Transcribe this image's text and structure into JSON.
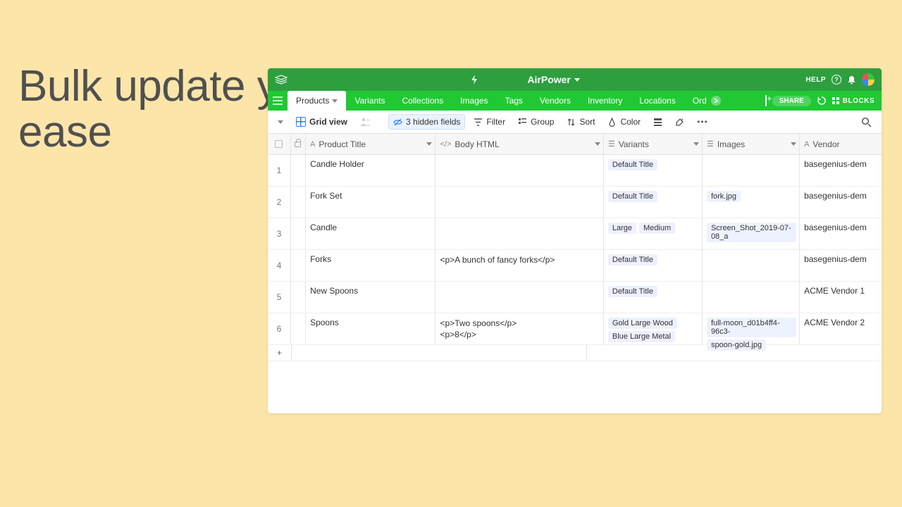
{
  "promo": "Bulk update your product information with ease",
  "app": {
    "name": "AirPower",
    "help": "HELP"
  },
  "tabs": {
    "items": [
      "Products",
      "Variants",
      "Collections",
      "Images",
      "Tags",
      "Vendors",
      "Inventory",
      "Locations",
      "Orders"
    ],
    "active_index": 0,
    "share": "SHARE",
    "blocks": "BLOCKS"
  },
  "toolbar": {
    "view_name": "Grid view",
    "hidden_fields": "3 hidden fields",
    "filter": "Filter",
    "group": "Group",
    "sort": "Sort",
    "color": "Color"
  },
  "columns": {
    "title": "Product Title",
    "body": "Body HTML",
    "variants": "Variants",
    "images": "Images",
    "vendor": "Vendor"
  },
  "rows": [
    {
      "n": "1",
      "title": "Candle Holder",
      "body": "",
      "variants": [
        "Default Title"
      ],
      "images": [],
      "vendor": "basegenius-dem"
    },
    {
      "n": "2",
      "title": "Fork Set",
      "body": "",
      "variants": [
        "Default Title"
      ],
      "images": [
        "fork.jpg"
      ],
      "vendor": "basegenius-dem"
    },
    {
      "n": "3",
      "title": "Candle",
      "body": "",
      "variants": [
        "Large",
        "Medium"
      ],
      "images": [
        "Screen_Shot_2019-07-08_a"
      ],
      "vendor": "basegenius-dem"
    },
    {
      "n": "4",
      "title": "Forks",
      "body": "<p>A bunch of fancy forks</p>",
      "variants": [
        "Default Title"
      ],
      "images": [],
      "vendor": "basegenius-dem"
    },
    {
      "n": "5",
      "title": "New Spoons",
      "body": "",
      "variants": [
        "Default Title"
      ],
      "images": [],
      "vendor": "ACME Vendor 1"
    },
    {
      "n": "6",
      "title": "Spoons",
      "body": "<p>Two spoons</p>\n<p>8</p>",
      "variants": [
        "Gold Large Wood",
        "Blue Large Metal"
      ],
      "images": [
        "full-moon_d01b4ff4-96c3-",
        "spoon-gold.jpg"
      ],
      "vendor": "ACME Vendor 2"
    }
  ]
}
